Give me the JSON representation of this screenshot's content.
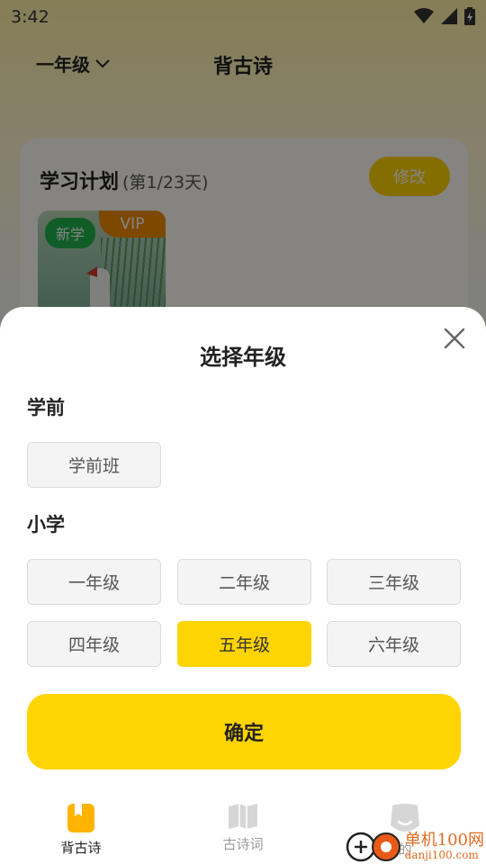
{
  "status": {
    "time": "3:42"
  },
  "header": {
    "grade": "一年级",
    "title": "背古诗"
  },
  "plan": {
    "title": "学习计划",
    "days": "(第1/23天)",
    "edit_label": "修改",
    "new_badge": "新学",
    "vip_badge": "VIP"
  },
  "sheet": {
    "title": "选择年级",
    "sections": [
      {
        "label": "学前",
        "options": [
          "学前班"
        ]
      },
      {
        "label": "小学",
        "options": [
          "一年级",
          "二年级",
          "三年级",
          "四年级",
          "五年级",
          "六年级"
        ]
      }
    ],
    "selected": "五年级",
    "confirm_label": "确定"
  },
  "tabs": [
    {
      "label": "背古诗",
      "icon": "bookmark-book-icon",
      "active": true
    },
    {
      "label": "古诗词",
      "icon": "open-book-icon",
      "active": false
    },
    {
      "label": "的",
      "icon": "profile-face-icon",
      "active": false
    }
  ],
  "watermark": {
    "main": "单机100网",
    "sub": "danji100.com"
  },
  "colors": {
    "accent": "#ffd400",
    "vip": "#f08a00",
    "new": "#22b24c"
  }
}
